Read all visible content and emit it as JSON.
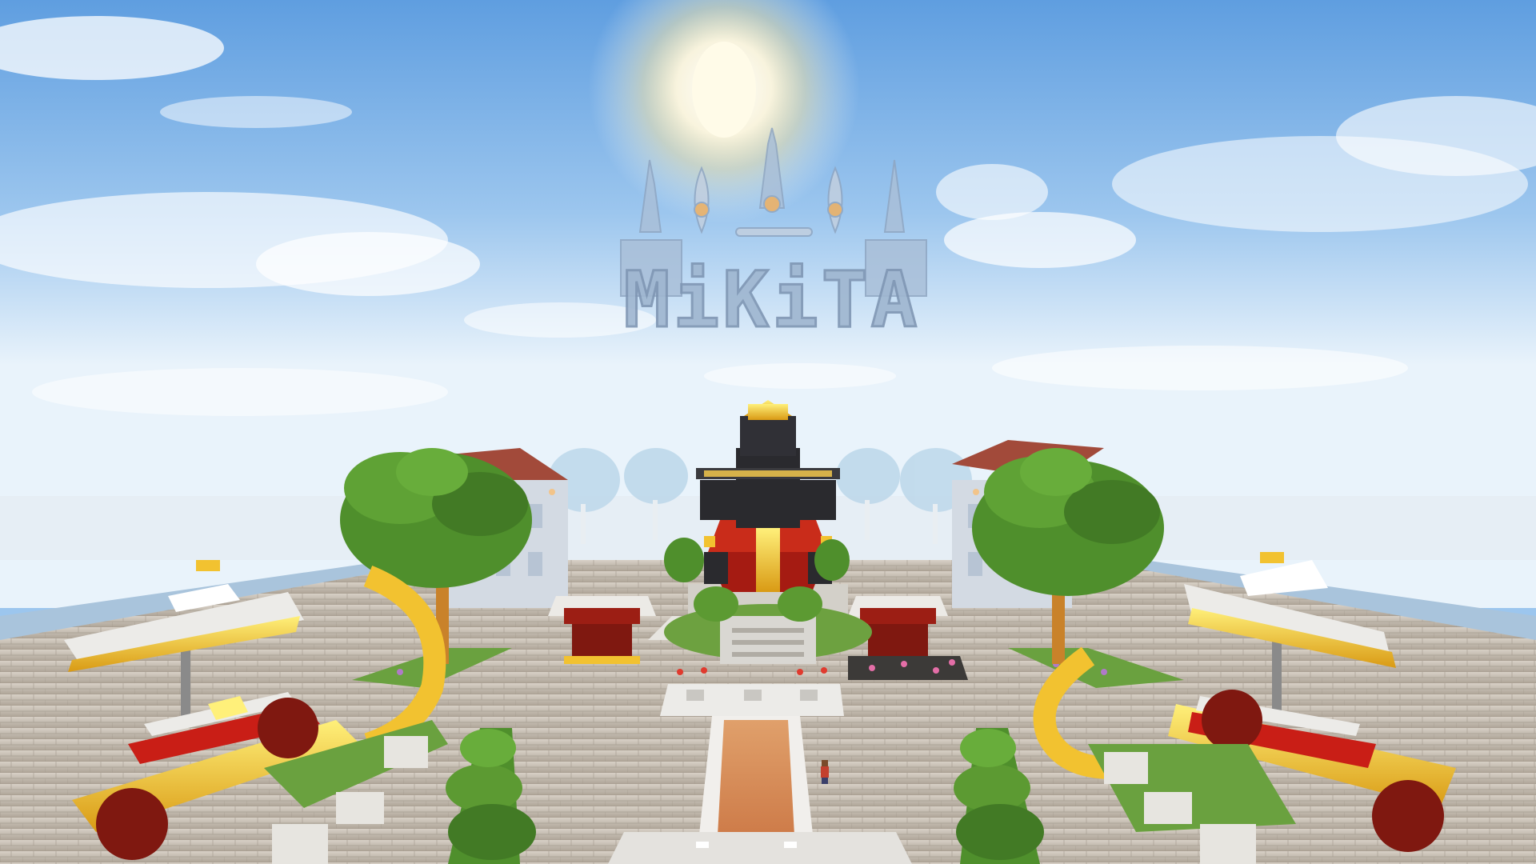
{
  "scene": {
    "title_sign": "MiKiTA",
    "colors": {
      "sky_top": "#5f9ee0",
      "sky_horizon": "#e9f3fb",
      "sun": "#fff6d8",
      "plaza_stone": "#bdb3a6",
      "wall": "#a9c4dc",
      "leaves": "#4f8f2c",
      "trunk": "#c9822a",
      "roof_red": "#9c1e14",
      "gold": "#f2c230",
      "statue_dark": "#2a2a2e",
      "path": "#d98a52",
      "white_marble": "#ecebe8"
    },
    "icons": [
      "sun-icon",
      "tree-icon",
      "statue-icon",
      "pavilion-icon",
      "naga-boat-icon",
      "player-icon"
    ]
  }
}
